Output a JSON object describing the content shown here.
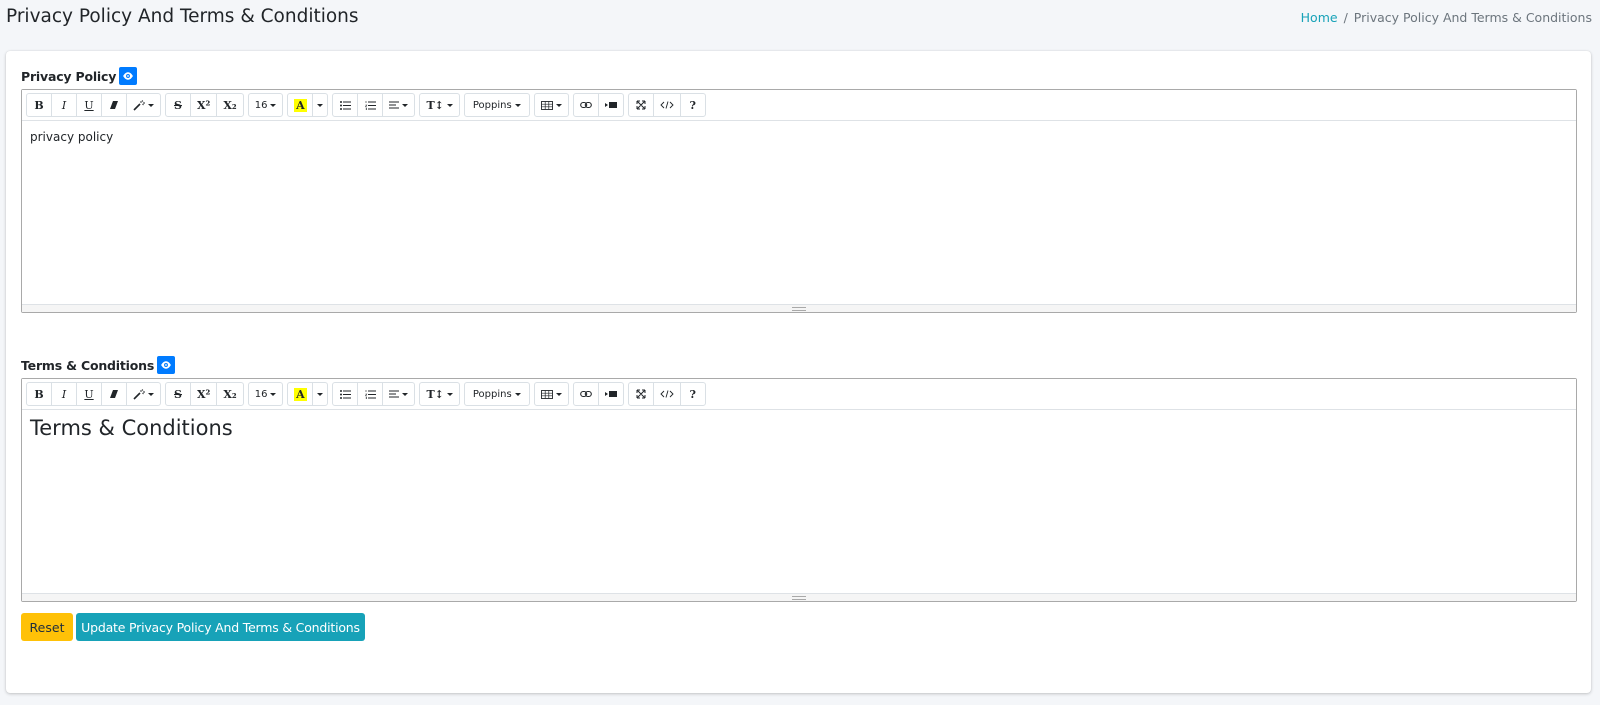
{
  "header": {
    "title": "Privacy Policy And Terms & Conditions",
    "breadcrumb": {
      "home": "Home",
      "separator": "/",
      "current": "Privacy Policy And Terms & Conditions"
    }
  },
  "toolbar": {
    "bold": "B",
    "italic": "I",
    "underline": "U",
    "superscript": "X²",
    "subscript": "X₂",
    "font_size": "16",
    "highlight_letter": "A",
    "line_height": "T↕",
    "font_family": "Poppins",
    "help": "?"
  },
  "privacy": {
    "label": "Privacy Policy",
    "content": "privacy policy"
  },
  "terms": {
    "label": "Terms & Conditions",
    "content": "Terms & Conditions"
  },
  "actions": {
    "reset": "Reset",
    "update": "Update Privacy Policy And Terms & Conditions"
  },
  "colors": {
    "background": "#f4f6f9",
    "primary": "#007bff",
    "info": "#17a2b8",
    "warning": "#ffc107",
    "highlight": "#ffff00"
  }
}
